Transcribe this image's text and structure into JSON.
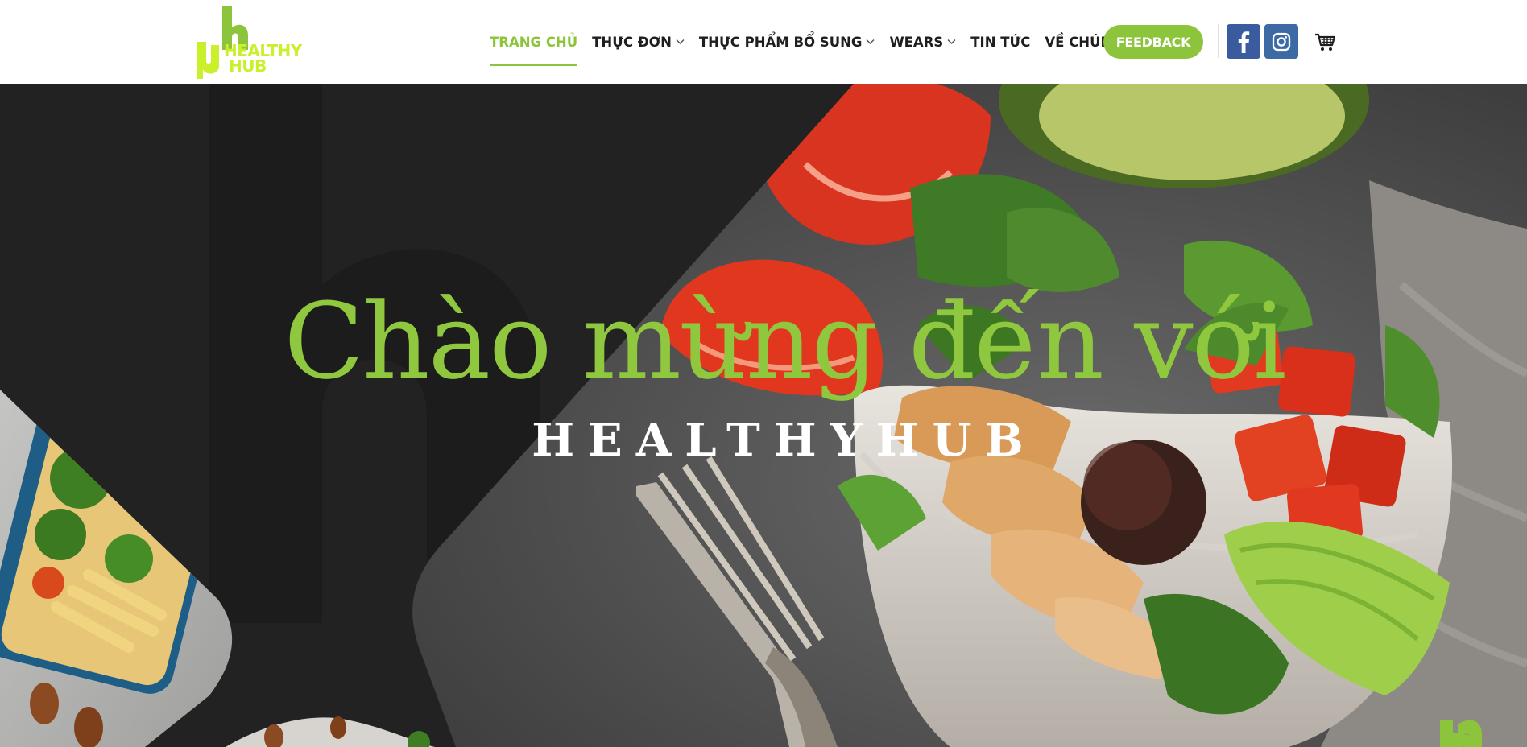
{
  "logo": {
    "line1": "HEALTHY",
    "line2": "HUB"
  },
  "nav": {
    "items": [
      {
        "label": "TRANG CHỦ",
        "active": true,
        "dropdown": false
      },
      {
        "label": "THỰC ĐƠN",
        "active": false,
        "dropdown": true
      },
      {
        "label": "THỰC PHẨM BỔ SUNG",
        "active": false,
        "dropdown": true
      },
      {
        "label": "WEARS",
        "active": false,
        "dropdown": true
      },
      {
        "label": "TIN TỨC",
        "active": false,
        "dropdown": false
      },
      {
        "label": "VỀ CHÚNG TÔI",
        "active": false,
        "dropdown": false
      }
    ],
    "feedback_label": "FEEDBACK"
  },
  "social": {
    "facebook_icon": "facebook-icon",
    "instagram_icon": "instagram-icon",
    "cart_icon": "cart-icon"
  },
  "hero": {
    "title": "Chào mừng đến với",
    "subtitle": "HEALTHYHUB"
  },
  "colors": {
    "accent": "#8cc43b",
    "facebook": "#3a5b9d",
    "instagram": "#3c6aa5",
    "dark": "#232323",
    "logo_yellow": "#c9f02a"
  }
}
